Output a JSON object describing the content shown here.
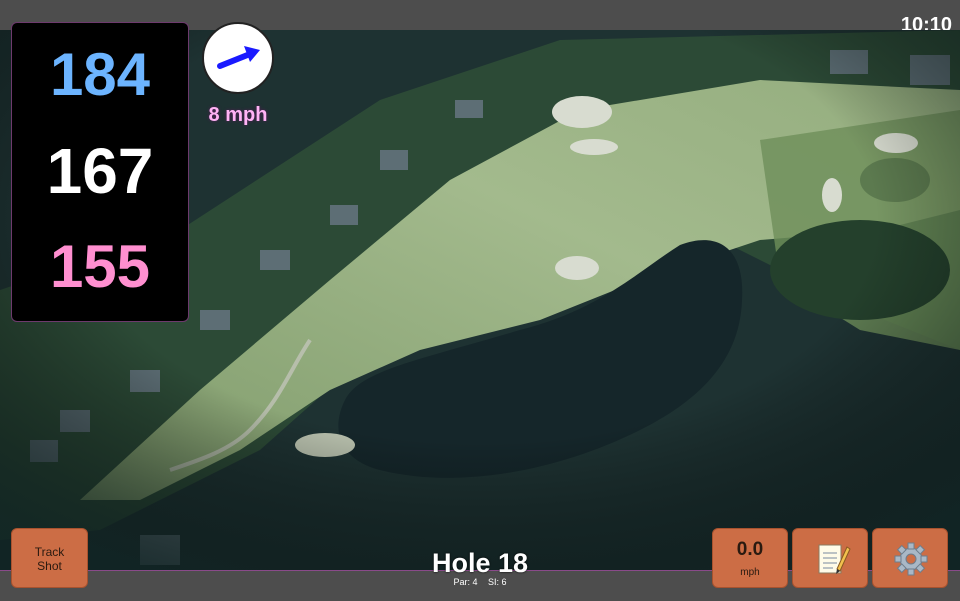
{
  "status_bar": {
    "time": "10:10"
  },
  "yardages": {
    "back": "184",
    "center": "167",
    "front": "155"
  },
  "wind": {
    "speed": "8 mph",
    "icon": "wind-arrow-icon"
  },
  "hole": {
    "title": "Hole 18",
    "par": "Par: 4",
    "stroke_index": "SI: 6"
  },
  "buttons": {
    "track_shot": "Track\nShot",
    "speed_value": "0.0",
    "speed_unit": "mph",
    "notes_icon": "notepad-icon",
    "settings_icon": "gear-icon"
  },
  "colors": {
    "back_yardage": "#6cb4ff",
    "center_yardage": "#ffffff",
    "front_yardage": "#ff8fd0",
    "button": "#cc6d45",
    "wind_arrow": "#1a1aff"
  }
}
